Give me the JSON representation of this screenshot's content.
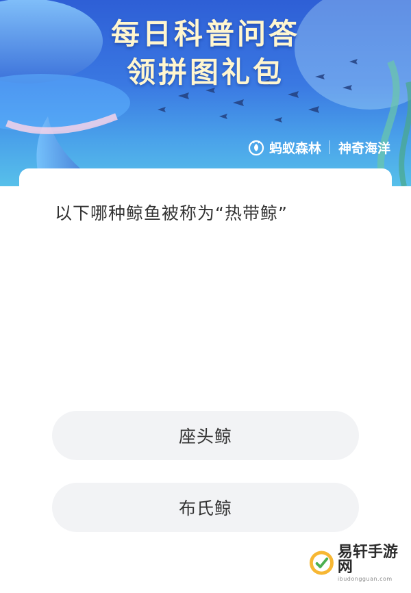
{
  "banner": {
    "title_line1": "每日科普问答",
    "title_line2": "领拼图礼包",
    "brand": "蚂蚁森林",
    "partner": "神奇海洋"
  },
  "quiz": {
    "question": "以下哪种鲸鱼被称为“热带鲸”",
    "options": [
      "座头鲸",
      "布氏鲸"
    ]
  },
  "watermark": {
    "name": "易轩手游网",
    "url": "ibudongguan.com"
  },
  "colors": {
    "banner_top": "#2e5fd6",
    "banner_bottom": "#57c0ea",
    "title_text": "#fff6cf",
    "option_bg": "#f2f3f5"
  }
}
